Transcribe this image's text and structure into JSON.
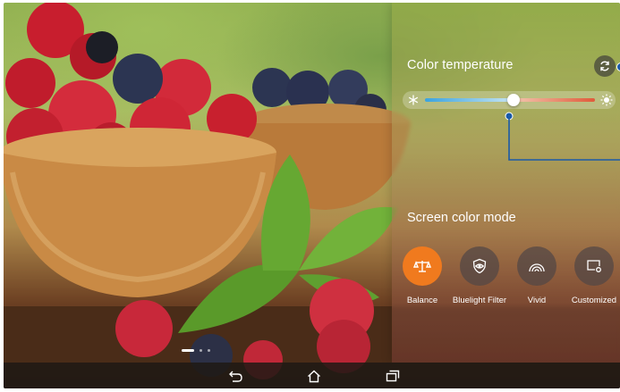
{
  "color_panel": {
    "title": "Color temperature",
    "slider_value": 0.52,
    "reset_icon": "refresh-icon",
    "cold_icon": "snowflake-icon",
    "warm_icon": "sun-icon"
  },
  "screen_mode": {
    "title": "Screen color mode",
    "modes": [
      {
        "label": "Balance",
        "icon": "balance-scale-icon",
        "active": true
      },
      {
        "label": "Bluelight Filter",
        "icon": "eye-shield-icon",
        "active": false
      },
      {
        "label": "Vivid",
        "icon": "rainbow-icon",
        "active": false
      },
      {
        "label": "Customized",
        "icon": "screen-settings-icon",
        "active": false
      }
    ]
  },
  "navbar": {
    "back_icon": "back-icon",
    "home_icon": "home-icon",
    "recents_icon": "recents-icon"
  },
  "colors": {
    "accent": "#f07a1e",
    "callout": "#1a5aa8"
  }
}
